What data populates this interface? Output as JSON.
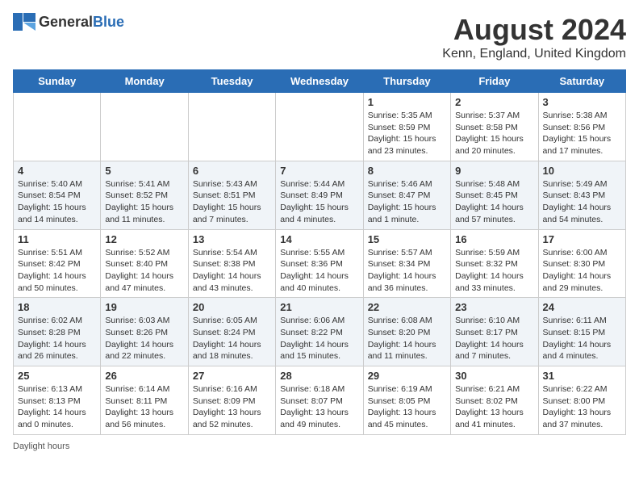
{
  "header": {
    "logo_general": "General",
    "logo_blue": "Blue",
    "month_year": "August 2024",
    "location": "Kenn, England, United Kingdom"
  },
  "days_of_week": [
    "Sunday",
    "Monday",
    "Tuesday",
    "Wednesday",
    "Thursday",
    "Friday",
    "Saturday"
  ],
  "footer": {
    "daylight_hours": "Daylight hours"
  },
  "weeks": [
    [
      {
        "day": "",
        "sunrise": "",
        "sunset": "",
        "daylight": ""
      },
      {
        "day": "",
        "sunrise": "",
        "sunset": "",
        "daylight": ""
      },
      {
        "day": "",
        "sunrise": "",
        "sunset": "",
        "daylight": ""
      },
      {
        "day": "",
        "sunrise": "",
        "sunset": "",
        "daylight": ""
      },
      {
        "day": "1",
        "sunrise": "Sunrise: 5:35 AM",
        "sunset": "Sunset: 8:59 PM",
        "daylight": "Daylight: 15 hours and 23 minutes."
      },
      {
        "day": "2",
        "sunrise": "Sunrise: 5:37 AM",
        "sunset": "Sunset: 8:58 PM",
        "daylight": "Daylight: 15 hours and 20 minutes."
      },
      {
        "day": "3",
        "sunrise": "Sunrise: 5:38 AM",
        "sunset": "Sunset: 8:56 PM",
        "daylight": "Daylight: 15 hours and 17 minutes."
      }
    ],
    [
      {
        "day": "4",
        "sunrise": "Sunrise: 5:40 AM",
        "sunset": "Sunset: 8:54 PM",
        "daylight": "Daylight: 15 hours and 14 minutes."
      },
      {
        "day": "5",
        "sunrise": "Sunrise: 5:41 AM",
        "sunset": "Sunset: 8:52 PM",
        "daylight": "Daylight: 15 hours and 11 minutes."
      },
      {
        "day": "6",
        "sunrise": "Sunrise: 5:43 AM",
        "sunset": "Sunset: 8:51 PM",
        "daylight": "Daylight: 15 hours and 7 minutes."
      },
      {
        "day": "7",
        "sunrise": "Sunrise: 5:44 AM",
        "sunset": "Sunset: 8:49 PM",
        "daylight": "Daylight: 15 hours and 4 minutes."
      },
      {
        "day": "8",
        "sunrise": "Sunrise: 5:46 AM",
        "sunset": "Sunset: 8:47 PM",
        "daylight": "Daylight: 15 hours and 1 minute."
      },
      {
        "day": "9",
        "sunrise": "Sunrise: 5:48 AM",
        "sunset": "Sunset: 8:45 PM",
        "daylight": "Daylight: 14 hours and 57 minutes."
      },
      {
        "day": "10",
        "sunrise": "Sunrise: 5:49 AM",
        "sunset": "Sunset: 8:43 PM",
        "daylight": "Daylight: 14 hours and 54 minutes."
      }
    ],
    [
      {
        "day": "11",
        "sunrise": "Sunrise: 5:51 AM",
        "sunset": "Sunset: 8:42 PM",
        "daylight": "Daylight: 14 hours and 50 minutes."
      },
      {
        "day": "12",
        "sunrise": "Sunrise: 5:52 AM",
        "sunset": "Sunset: 8:40 PM",
        "daylight": "Daylight: 14 hours and 47 minutes."
      },
      {
        "day": "13",
        "sunrise": "Sunrise: 5:54 AM",
        "sunset": "Sunset: 8:38 PM",
        "daylight": "Daylight: 14 hours and 43 minutes."
      },
      {
        "day": "14",
        "sunrise": "Sunrise: 5:55 AM",
        "sunset": "Sunset: 8:36 PM",
        "daylight": "Daylight: 14 hours and 40 minutes."
      },
      {
        "day": "15",
        "sunrise": "Sunrise: 5:57 AM",
        "sunset": "Sunset: 8:34 PM",
        "daylight": "Daylight: 14 hours and 36 minutes."
      },
      {
        "day": "16",
        "sunrise": "Sunrise: 5:59 AM",
        "sunset": "Sunset: 8:32 PM",
        "daylight": "Daylight: 14 hours and 33 minutes."
      },
      {
        "day": "17",
        "sunrise": "Sunrise: 6:00 AM",
        "sunset": "Sunset: 8:30 PM",
        "daylight": "Daylight: 14 hours and 29 minutes."
      }
    ],
    [
      {
        "day": "18",
        "sunrise": "Sunrise: 6:02 AM",
        "sunset": "Sunset: 8:28 PM",
        "daylight": "Daylight: 14 hours and 26 minutes."
      },
      {
        "day": "19",
        "sunrise": "Sunrise: 6:03 AM",
        "sunset": "Sunset: 8:26 PM",
        "daylight": "Daylight: 14 hours and 22 minutes."
      },
      {
        "day": "20",
        "sunrise": "Sunrise: 6:05 AM",
        "sunset": "Sunset: 8:24 PM",
        "daylight": "Daylight: 14 hours and 18 minutes."
      },
      {
        "day": "21",
        "sunrise": "Sunrise: 6:06 AM",
        "sunset": "Sunset: 8:22 PM",
        "daylight": "Daylight: 14 hours and 15 minutes."
      },
      {
        "day": "22",
        "sunrise": "Sunrise: 6:08 AM",
        "sunset": "Sunset: 8:20 PM",
        "daylight": "Daylight: 14 hours and 11 minutes."
      },
      {
        "day": "23",
        "sunrise": "Sunrise: 6:10 AM",
        "sunset": "Sunset: 8:17 PM",
        "daylight": "Daylight: 14 hours and 7 minutes."
      },
      {
        "day": "24",
        "sunrise": "Sunrise: 6:11 AM",
        "sunset": "Sunset: 8:15 PM",
        "daylight": "Daylight: 14 hours and 4 minutes."
      }
    ],
    [
      {
        "day": "25",
        "sunrise": "Sunrise: 6:13 AM",
        "sunset": "Sunset: 8:13 PM",
        "daylight": "Daylight: 14 hours and 0 minutes."
      },
      {
        "day": "26",
        "sunrise": "Sunrise: 6:14 AM",
        "sunset": "Sunset: 8:11 PM",
        "daylight": "Daylight: 13 hours and 56 minutes."
      },
      {
        "day": "27",
        "sunrise": "Sunrise: 6:16 AM",
        "sunset": "Sunset: 8:09 PM",
        "daylight": "Daylight: 13 hours and 52 minutes."
      },
      {
        "day": "28",
        "sunrise": "Sunrise: 6:18 AM",
        "sunset": "Sunset: 8:07 PM",
        "daylight": "Daylight: 13 hours and 49 minutes."
      },
      {
        "day": "29",
        "sunrise": "Sunrise: 6:19 AM",
        "sunset": "Sunset: 8:05 PM",
        "daylight": "Daylight: 13 hours and 45 minutes."
      },
      {
        "day": "30",
        "sunrise": "Sunrise: 6:21 AM",
        "sunset": "Sunset: 8:02 PM",
        "daylight": "Daylight: 13 hours and 41 minutes."
      },
      {
        "day": "31",
        "sunrise": "Sunrise: 6:22 AM",
        "sunset": "Sunset: 8:00 PM",
        "daylight": "Daylight: 13 hours and 37 minutes."
      }
    ]
  ]
}
